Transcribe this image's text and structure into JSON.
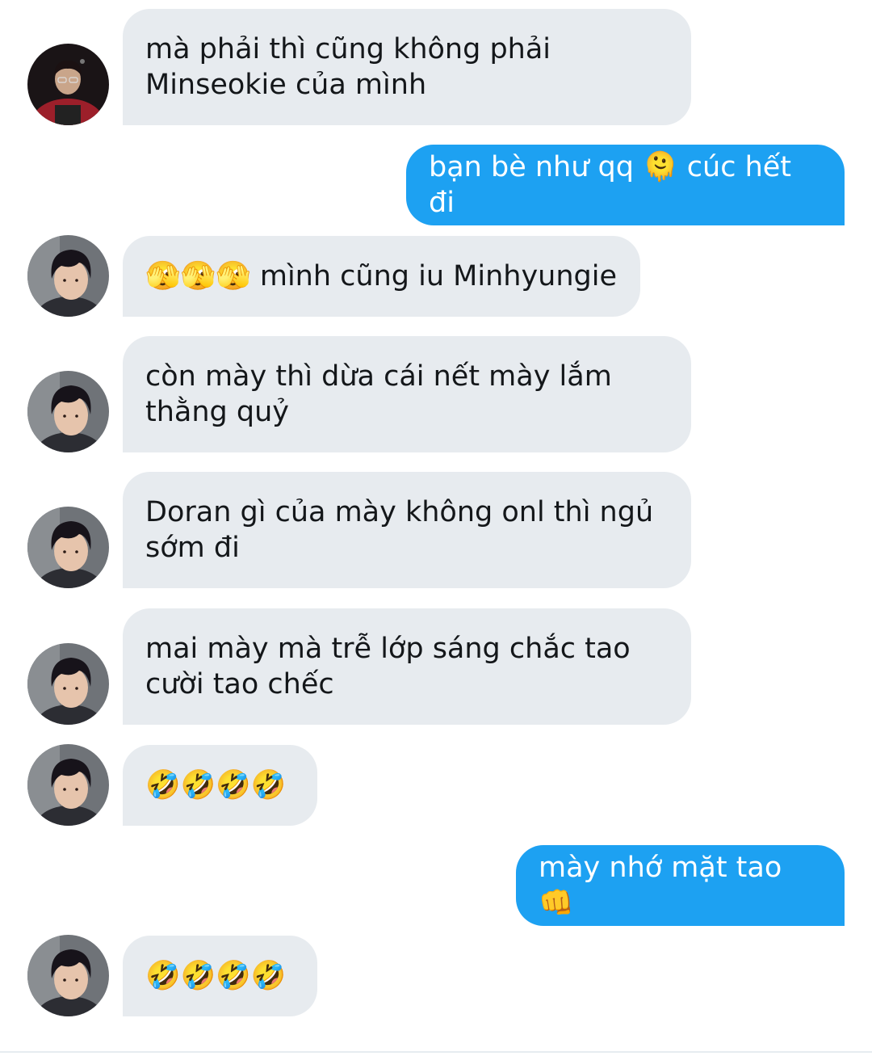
{
  "conversation": {
    "messages": [
      {
        "side": "in",
        "avatar": "avatar-a",
        "text": "mà phải thì cũng không phải\nMinseokie của mình"
      },
      {
        "side": "out",
        "text": "bạn bè như qq 🫠 cúc hết đi"
      },
      {
        "side": "in",
        "avatar": "avatar-b",
        "text": "🫣🫣🫣 mình cũng iu Minhyungie"
      },
      {
        "side": "in",
        "avatar": "avatar-b",
        "text": "còn mày thì dừa cái nết mày lắm\nthằng quỷ"
      },
      {
        "side": "in",
        "avatar": "avatar-b",
        "text": "Doran gì của mày không onl thì ngủ\nsớm đi"
      },
      {
        "side": "in",
        "avatar": "avatar-b",
        "text": "mai mày mà trễ lớp sáng chắc tao\ncười tao chếc"
      },
      {
        "side": "in",
        "avatar": "avatar-b",
        "text": "🤣🤣🤣🤣"
      },
      {
        "side": "out",
        "text": "mày nhớ mặt tao 👊"
      },
      {
        "side": "in",
        "avatar": "avatar-b",
        "text": "🤣🤣🤣🤣"
      }
    ]
  },
  "colors": {
    "incoming_bubble": "#e7ebef",
    "outgoing_bubble": "#1da1f2",
    "incoming_text": "#14171a",
    "outgoing_text": "#ffffff"
  }
}
